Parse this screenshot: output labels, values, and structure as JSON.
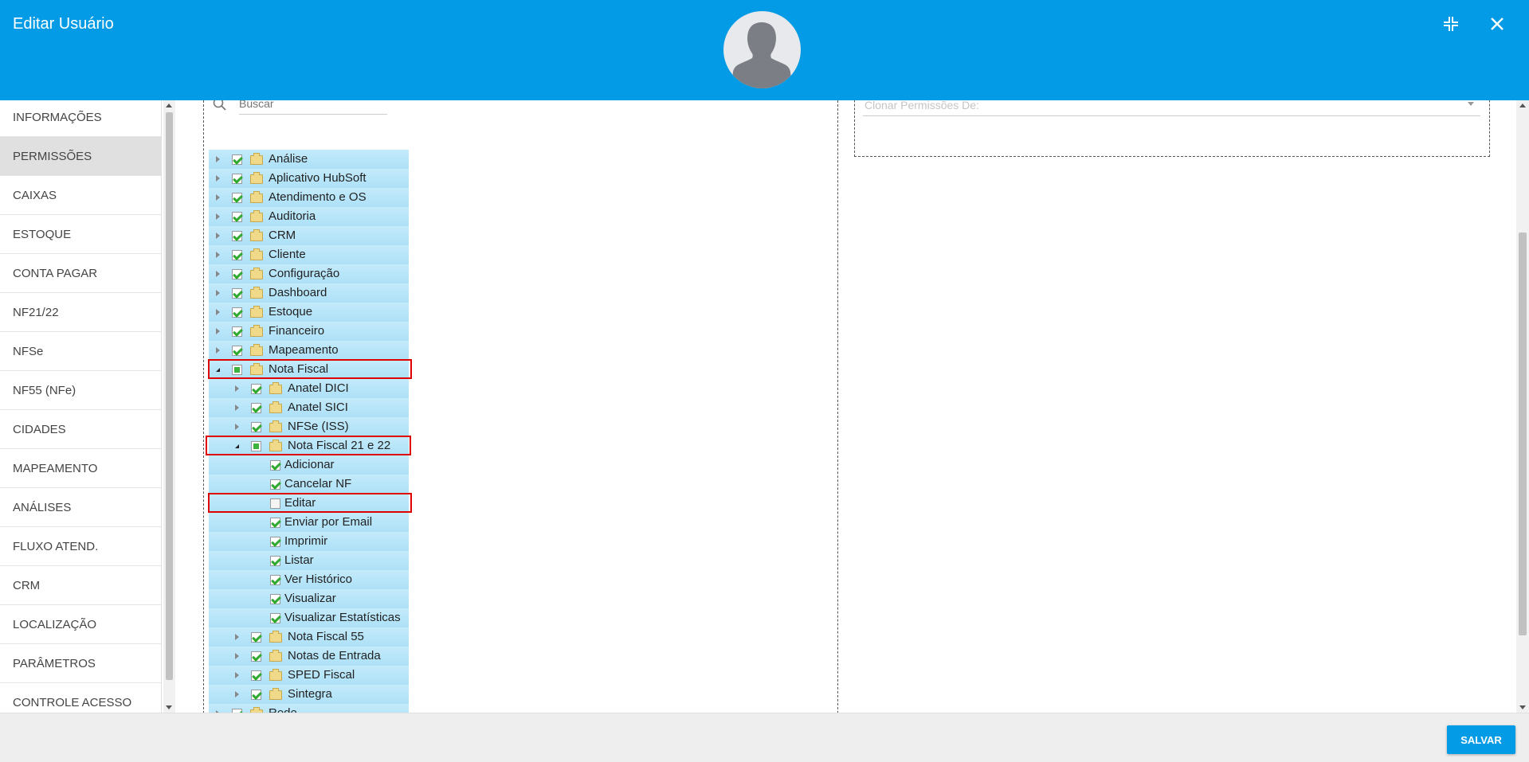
{
  "header": {
    "title": "Editar Usuário",
    "avatar_icon": "user-silhouette-icon",
    "collapse_icon": "collapse-arrows-icon",
    "close_icon": "close-icon",
    "background": "#039be5"
  },
  "sidebar": {
    "active_index": 1,
    "items": [
      {
        "label": "INFORMAÇÕES"
      },
      {
        "label": "PERMISSÕES"
      },
      {
        "label": "CAIXAS"
      },
      {
        "label": "ESTOQUE"
      },
      {
        "label": "CONTA PAGAR"
      },
      {
        "label": "NF21/22"
      },
      {
        "label": "NFSe"
      },
      {
        "label": "NF55 (NFe)"
      },
      {
        "label": "CIDADES"
      },
      {
        "label": "MAPEAMENTO"
      },
      {
        "label": "ANÁLISES"
      },
      {
        "label": "FLUXO ATEND."
      },
      {
        "label": "CRM"
      },
      {
        "label": "LOCALIZAÇÃO"
      },
      {
        "label": "PARÂMETROS"
      },
      {
        "label": "CONTROLE ACESSO"
      }
    ]
  },
  "search": {
    "placeholder": "Buscar",
    "icon": "search-icon"
  },
  "clone": {
    "placeholder": "Clonar Permissões De:"
  },
  "tree": [
    {
      "label": "Análise",
      "level": 0,
      "expander": "closed",
      "state": "checked",
      "folder": true
    },
    {
      "label": "Aplicativo HubSoft",
      "level": 0,
      "expander": "closed",
      "state": "checked",
      "folder": true
    },
    {
      "label": "Atendimento e OS",
      "level": 0,
      "expander": "closed",
      "state": "checked",
      "folder": true
    },
    {
      "label": "Auditoria",
      "level": 0,
      "expander": "closed",
      "state": "checked",
      "folder": true
    },
    {
      "label": "CRM",
      "level": 0,
      "expander": "closed",
      "state": "checked",
      "folder": true
    },
    {
      "label": "Cliente",
      "level": 0,
      "expander": "closed",
      "state": "checked",
      "folder": true
    },
    {
      "label": "Configuração",
      "level": 0,
      "expander": "closed",
      "state": "checked",
      "folder": true
    },
    {
      "label": "Dashboard",
      "level": 0,
      "expander": "closed",
      "state": "checked",
      "folder": true
    },
    {
      "label": "Estoque",
      "level": 0,
      "expander": "closed",
      "state": "checked",
      "folder": true
    },
    {
      "label": "Financeiro",
      "level": 0,
      "expander": "closed",
      "state": "checked",
      "folder": true
    },
    {
      "label": "Mapeamento",
      "level": 0,
      "expander": "closed",
      "state": "checked",
      "folder": true
    },
    {
      "label": "Nota Fiscal",
      "level": 0,
      "expander": "open",
      "state": "partial",
      "folder": true,
      "highlight": true
    },
    {
      "label": "Anatel DICI",
      "level": 1,
      "expander": "closed",
      "state": "checked",
      "folder": true
    },
    {
      "label": "Anatel SICI",
      "level": 1,
      "expander": "closed",
      "state": "checked",
      "folder": true
    },
    {
      "label": "NFSe (ISS)",
      "level": 1,
      "expander": "closed",
      "state": "checked",
      "folder": true
    },
    {
      "label": "Nota Fiscal 21 e 22",
      "level": 1,
      "expander": "open",
      "state": "partial",
      "folder": true,
      "highlight": true
    },
    {
      "label": "Adicionar",
      "level": 2,
      "expander": "none",
      "state": "checked",
      "folder": false
    },
    {
      "label": "Cancelar NF",
      "level": 2,
      "expander": "none",
      "state": "checked",
      "folder": false
    },
    {
      "label": "Editar",
      "level": 2,
      "expander": "none",
      "state": "unchecked",
      "folder": false,
      "highlight": true
    },
    {
      "label": "Enviar por Email",
      "level": 2,
      "expander": "none",
      "state": "checked",
      "folder": false
    },
    {
      "label": "Imprimir",
      "level": 2,
      "expander": "none",
      "state": "checked",
      "folder": false
    },
    {
      "label": "Listar",
      "level": 2,
      "expander": "none",
      "state": "checked",
      "folder": false
    },
    {
      "label": "Ver Histórico",
      "level": 2,
      "expander": "none",
      "state": "checked",
      "folder": false
    },
    {
      "label": "Visualizar",
      "level": 2,
      "expander": "none",
      "state": "checked",
      "folder": false
    },
    {
      "label": "Visualizar Estatísticas",
      "level": 2,
      "expander": "none",
      "state": "checked",
      "folder": false
    },
    {
      "label": "Nota Fiscal 55",
      "level": 1,
      "expander": "closed",
      "state": "checked",
      "folder": true
    },
    {
      "label": "Notas de Entrada",
      "level": 1,
      "expander": "closed",
      "state": "checked",
      "folder": true
    },
    {
      "label": "SPED Fiscal",
      "level": 1,
      "expander": "closed",
      "state": "checked",
      "folder": true
    },
    {
      "label": "Sintegra",
      "level": 1,
      "expander": "closed",
      "state": "checked",
      "folder": true
    },
    {
      "label": "Rede",
      "level": 0,
      "expander": "closed",
      "state": "checked",
      "folder": true
    }
  ],
  "footer": {
    "save_label": "SALVAR"
  }
}
